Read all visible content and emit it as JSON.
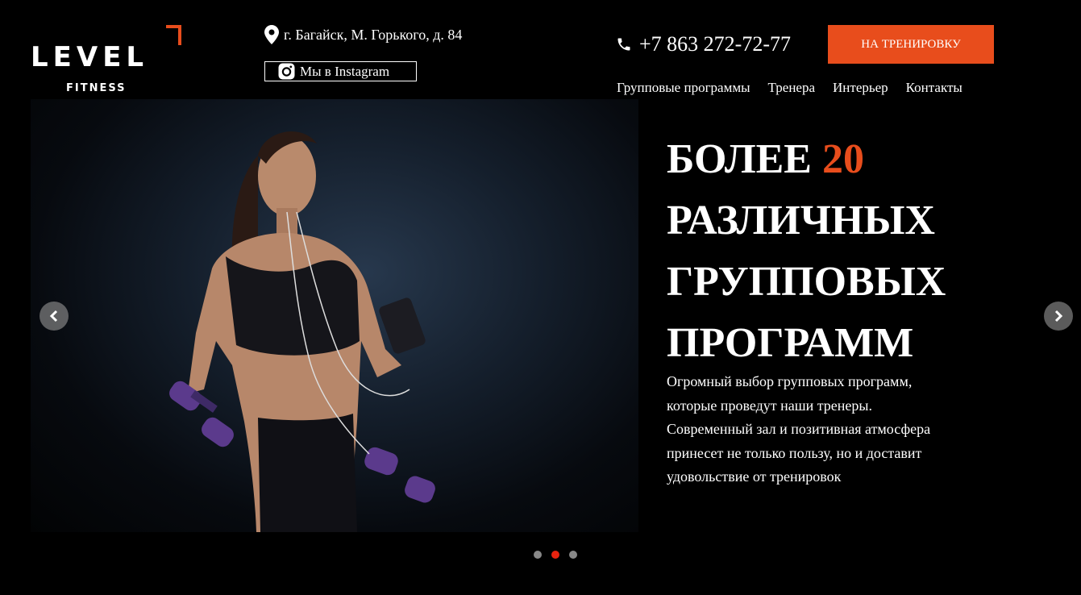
{
  "logo": {
    "word": "LEVEL",
    "sub": "FITNESS"
  },
  "header": {
    "address": "г. Багайск, М. Горького, д. 84",
    "instagram_label": "Мы в Instagram",
    "phone": "+7 863 272-72-77",
    "cta_label": "НА ТРЕНИРОВКУ"
  },
  "nav": {
    "items": [
      "Групповые программы",
      "Тренера",
      "Интерьер",
      "Контакты"
    ]
  },
  "hero": {
    "headline_prefix": "БОЛЕЕ",
    "headline_number": "20",
    "headline_lines": [
      "РАЗЛИЧНЫХ",
      "ГРУППОВЫХ",
      "ПРОГРАММ"
    ],
    "description": "Огромный выбор групповых программ, которые проведут наши тренеры. Современный зал и позитивная атмосфера принесет не только пользу, но и доставит удовольствие от тренировок"
  },
  "slider": {
    "count": 3,
    "active_index": 1
  },
  "colors": {
    "accent": "#e84d1c",
    "background": "#000000",
    "dot_active": "#e8230f",
    "dot_inactive": "#888888"
  },
  "icons": [
    "location-pin-icon",
    "instagram-icon",
    "phone-icon",
    "arrow-left-icon",
    "arrow-right-icon"
  ]
}
